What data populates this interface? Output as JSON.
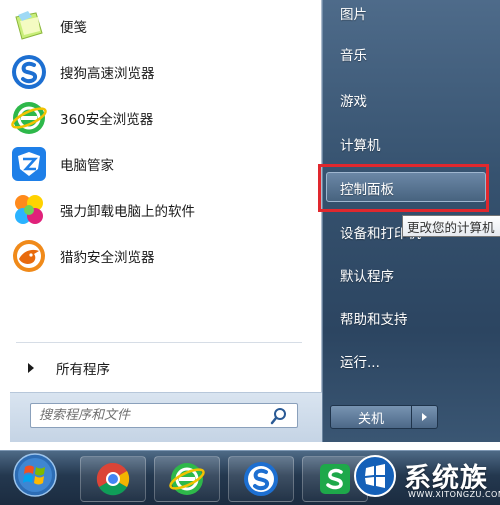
{
  "start_menu": {
    "programs": [
      {
        "label": "便笺",
        "icon": "sticky-notes-icon"
      },
      {
        "label": "搜狗高速浏览器",
        "icon": "sogou-browser-icon"
      },
      {
        "label": "360安全浏览器",
        "icon": "360-browser-icon"
      },
      {
        "label": "电脑管家",
        "icon": "pc-manager-shield-icon"
      },
      {
        "label": "强力卸载电脑上的软件",
        "icon": "uninstaller-clover-icon"
      },
      {
        "label": "猎豹安全浏览器",
        "icon": "cheetah-browser-icon"
      }
    ],
    "all_programs_label": "所有程序",
    "search": {
      "placeholder": "搜索程序和文件",
      "icon": "search-icon"
    },
    "right_items": {
      "pictures": "图片",
      "music": "音乐",
      "games": "游戏",
      "computer": "计算机",
      "control_panel": "控制面板",
      "devices_printers": "设备和打印机",
      "default_programs": "默认程序",
      "help_support": "帮助和支持",
      "run": "运行..."
    },
    "tooltip": "更改您的计算机",
    "shutdown_label": "关机",
    "highlight_color": "#e0282e"
  },
  "taskbar": {
    "items": [
      {
        "icon": "windows-start-orb-icon"
      },
      {
        "icon": "chrome-icon"
      },
      {
        "icon": "360-browser-icon"
      },
      {
        "icon": "sogou-browser-icon"
      },
      {
        "icon": "green-s-app-icon"
      }
    ]
  },
  "watermark": {
    "text": "系统族",
    "url": "WWW.XITONGZU.COM"
  }
}
